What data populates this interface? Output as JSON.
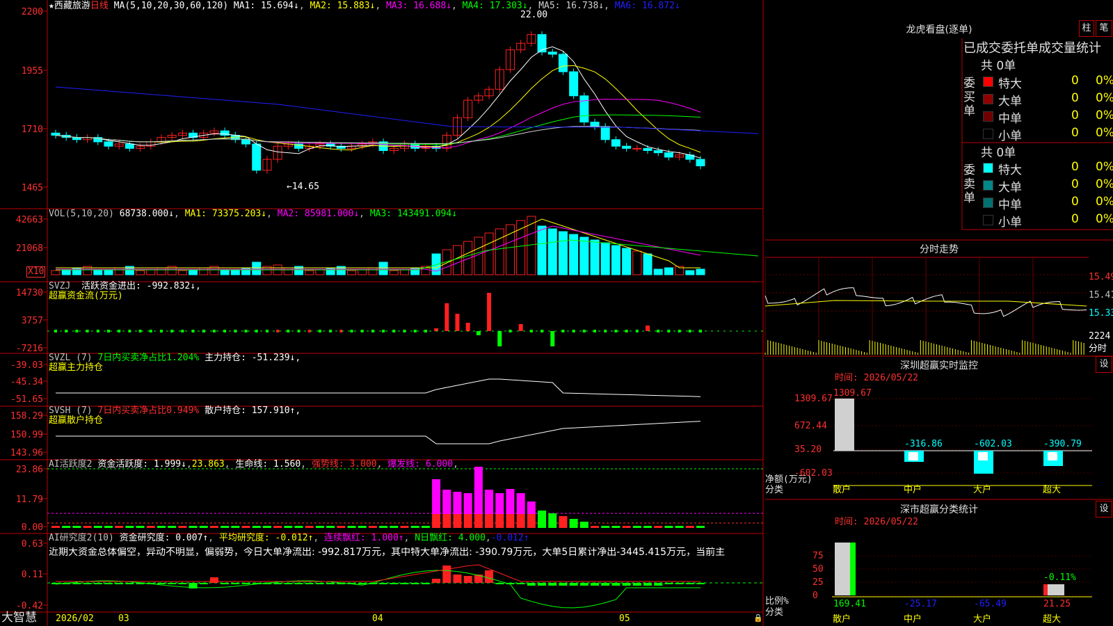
{
  "colors": {
    "bg": "#000000",
    "grid": "#c00000",
    "up": "#ff2020",
    "down": "#00ffff",
    "ma1": "#ffffff",
    "ma2": "#ffff00",
    "ma3": "#ff00ff",
    "ma4": "#00ff00",
    "ma5": "#d0d0d0",
    "ma6": "#2020ff",
    "label_red": "#ff3030"
  },
  "app": {
    "name": "大智慧"
  },
  "stock": {
    "name": "西藏旅游",
    "period": "日线",
    "ma_params": "MA(5,10,20,30,60,120)",
    "ma": [
      {
        "label": "MA1: 15.694↓"
      },
      {
        "label": "MA2: 15.883↓"
      },
      {
        "label": "MA3: 16.688↓"
      },
      {
        "label": "MA4: 17.303↓"
      },
      {
        "label": "MA5: 16.738↓"
      },
      {
        "label": "MA6: 16.872↓"
      }
    ],
    "y_ticks": [
      "2200",
      "1955",
      "1710",
      "1465"
    ],
    "high_mark": "22.00",
    "low_mark": "←14.65"
  },
  "vol": {
    "title": "VOL(5,10,20)",
    "value": "68738.000↓",
    "ma1": "MA1: 73375.203↓",
    "ma2": "MA2: 85981.000↓",
    "ma3": "MA3: 143491.094↓",
    "y_ticks": [
      "42663",
      "21068"
    ],
    "unit": "X10"
  },
  "svzj": {
    "title": "SVZJ",
    "line1": "活跃资金进出: -992.832↓,",
    "line2": "超赢资金流(万元)",
    "y_ticks": [
      "14730",
      "3757",
      "-7216"
    ]
  },
  "svzl": {
    "title": "SVZL (7)",
    "pct": "7日内买卖净占比1.204%",
    "value": "主力持仓: -51.239↓,",
    "line2": "超赢主力持仓",
    "y_ticks": [
      "-39.03",
      "-45.34",
      "-51.65"
    ]
  },
  "svsh": {
    "title": "SVSH (7)",
    "pct": "7日内买卖净占比0.949%",
    "value": "散户持仓: 157.910↑,",
    "line2": "超赢散户持仓",
    "y_ticks": [
      "158.29",
      "150.99",
      "143.96"
    ]
  },
  "ai2": {
    "title": "AI活跃度2",
    "v1": "资金活跃度: 1.999↓",
    "v2": "23.863",
    "v3": "生命线: 1.560",
    "v4": "强势线: 3.000",
    "v5": "爆发线: 6.000",
    "y_ticks": [
      "23.86",
      "11.79",
      "0.00"
    ]
  },
  "ai_res": {
    "title": "AI研究度2(10)",
    "v1": "资金研究度: 0.007↑",
    "v2": "平均研究度: -0.012↑",
    "v3": "连续飘红: 1.000↑",
    "v4": "N日飘红: 4.000",
    "v5": "-0.012↑",
    "note": "近期大资金总体偏空，异动不明显，偏弱势，今日大单净流出: -992.817万元，其中特大单净流出: -390.79万元，大单5日累计净出-3445.415万元，当前主",
    "y_ticks": [
      "0.63",
      "0.11",
      "-0.42"
    ]
  },
  "dates": {
    "first": "2026/02",
    "m1": "03",
    "m2": "04",
    "m3": "05"
  },
  "lhb": {
    "title": "龙虎看盘(逐单)",
    "btn1": "柱",
    "btn2": "笔",
    "subtitle": "已成交委托单成交量统计",
    "buy": {
      "label": "委买单",
      "total": "共 0单",
      "rows": [
        {
          "name": "特大",
          "n": "0",
          "p": "0%",
          "c": "#ff0000"
        },
        {
          "name": "大单",
          "n": "0",
          "p": "0%",
          "c": "#900000"
        },
        {
          "name": "中单",
          "n": "0",
          "p": "0%",
          "c": "#700000"
        },
        {
          "name": "小单",
          "n": "0",
          "p": "0%",
          "c": "#000000"
        }
      ]
    },
    "sell": {
      "label": "委卖单",
      "total": "共 0单",
      "rows": [
        {
          "name": "特大",
          "n": "0",
          "p": "0%",
          "c": "#00ffff"
        },
        {
          "name": "大单",
          "n": "0",
          "p": "0%",
          "c": "#008888"
        },
        {
          "name": "中单",
          "n": "0",
          "p": "0%",
          "c": "#007070"
        },
        {
          "name": "小单",
          "n": "0",
          "p": "0%",
          "c": "#000000"
        }
      ]
    }
  },
  "intraday": {
    "title": "分时走势",
    "ticks": [
      "15.49",
      "15.41",
      "15.33"
    ],
    "vol": "2224",
    "vol_unit": "分时"
  },
  "sz_monitor": {
    "title": "深圳超赢实时监控",
    "btn": "设",
    "time": "时间: 2026/05/22",
    "ylabel1": "净额(万元)",
    "ylabel2": "分类",
    "y_ticks": [
      "1309.67",
      "672.44",
      "35.20",
      "-602.03"
    ],
    "cats": [
      {
        "name": "散户",
        "value": "1309.67"
      },
      {
        "name": "中户",
        "value": "-316.86"
      },
      {
        "name": "大户",
        "value": "-602.03"
      },
      {
        "name": "超大",
        "value": "-390.79"
      }
    ]
  },
  "sz_class": {
    "title": "深市超赢分类统计",
    "btn": "设",
    "time": "时间: 2026/05/22",
    "ylabel1": "比例%",
    "ylabel2": "分类",
    "y_ticks": [
      "75",
      "50",
      "25",
      "0"
    ],
    "label_top": "-0.11%",
    "cats": [
      {
        "name": "散户",
        "value": "169.41"
      },
      {
        "name": "中户",
        "value": "-25.17"
      },
      {
        "name": "大户",
        "value": "-65.49"
      },
      {
        "name": "超大",
        "value": "21.25"
      }
    ]
  },
  "chart_data": {
    "type": "candlestick",
    "price_low": 14.65,
    "price_high": 22.0,
    "closes": [
      16.6,
      16.5,
      16.4,
      16.5,
      16.3,
      16.1,
      16.2,
      16.0,
      16.1,
      16.3,
      16.5,
      16.6,
      16.7,
      16.5,
      16.7,
      16.8,
      16.6,
      16.4,
      16.2,
      15.0,
      15.5,
      16.1,
      16.2,
      16.0,
      16.1,
      16.2,
      16.1,
      16.0,
      16.1,
      16.2,
      16.3,
      15.9,
      16.0,
      16.2,
      16.0,
      16.1,
      16.0,
      16.6,
      17.4,
      18.2,
      18.4,
      18.7,
      19.6,
      20.5,
      20.8,
      21.2,
      20.4,
      20.3,
      19.5,
      18.4,
      17.2,
      17.0,
      16.4,
      16.1,
      16.0,
      16.0,
      15.9,
      15.8,
      15.6,
      15.7,
      15.5,
      15.2
    ]
  }
}
